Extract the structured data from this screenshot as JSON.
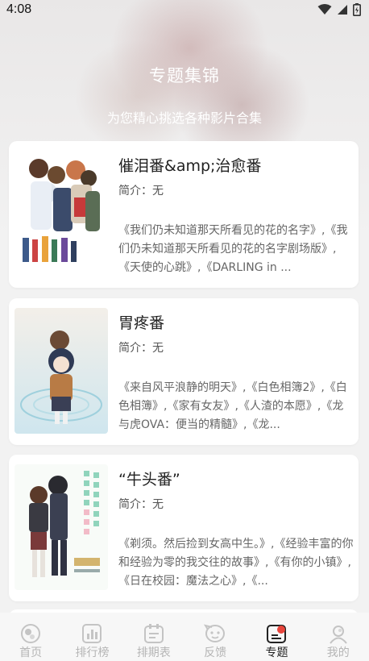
{
  "status": {
    "time": "4:08"
  },
  "header": {
    "title": "专题集锦",
    "subtitle": "为您精心挑选各种影片合集"
  },
  "cards": [
    {
      "title": "催泪番&amp;治愈番",
      "intro": "简介：无",
      "list": "《我们仍未知道那天所看见的花的名字》,《我们仍未知道那天所看见的花的名字剧场版》,《天使的心跳》,《DARLING in ..."
    },
    {
      "title": "胃疼番",
      "intro": "简介：无",
      "list": "《来自风平浪静的明天》,《白色相簿2》,《白色相簿》,《家有女友》,《人渣的本愿》,《龙与虎OVA：便当的精髓》,《龙..."
    },
    {
      "title": "“牛头番”",
      "intro": "简介：无",
      "list": "《剃须。然后捡到女高中生。》,《经验丰富的你和经验为零的我交往的故事》,《有你的小镇》,《日在校园：魔法之心》,《..."
    }
  ],
  "tabs": [
    {
      "label": "首页",
      "icon": "home-icon"
    },
    {
      "label": "排行榜",
      "icon": "ranking-icon"
    },
    {
      "label": "排期表",
      "icon": "schedule-icon"
    },
    {
      "label": "反馈",
      "icon": "feedback-icon"
    },
    {
      "label": "专题",
      "icon": "topic-icon",
      "active": true
    },
    {
      "label": "我的",
      "icon": "profile-icon"
    }
  ],
  "colors": {
    "accent": "#e8453c",
    "inactive": "#b5b5b5",
    "active_text": "#222222"
  }
}
